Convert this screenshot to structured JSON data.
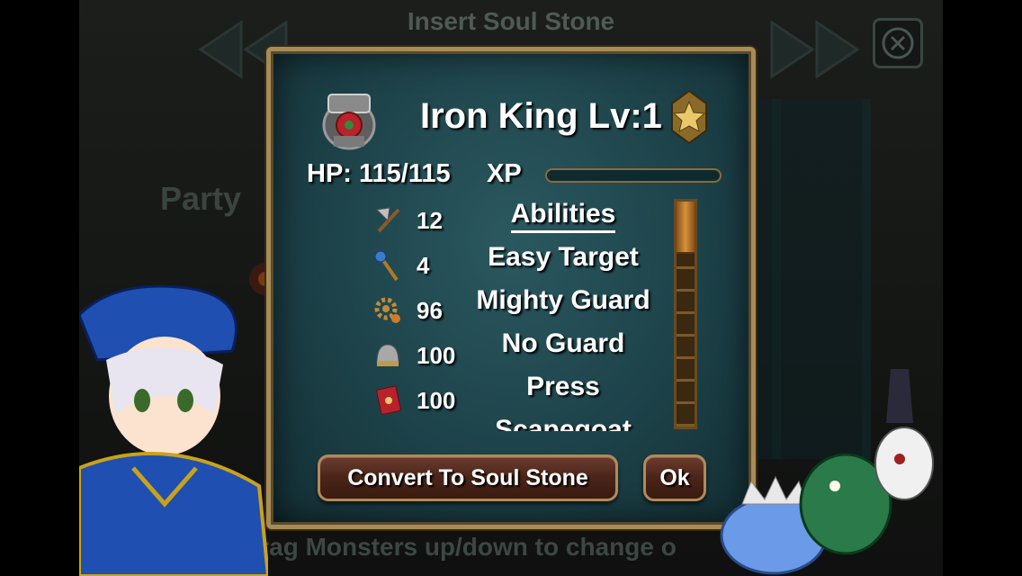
{
  "background": {
    "title": "Insert Soul Stone",
    "party_label": "Party",
    "hint": "Drag Monsters up/down to change o"
  },
  "dialog": {
    "title": "Iron King Lv:1",
    "hp": "HP: 115/115",
    "xp_label": "XP",
    "xp_fraction": 0,
    "stats": [
      {
        "icon": "axe-icon",
        "value": "12"
      },
      {
        "icon": "staff-icon",
        "value": "4"
      },
      {
        "icon": "gear-icon",
        "value": "96"
      },
      {
        "icon": "helmet-icon",
        "value": "100"
      },
      {
        "icon": "spellbook-icon",
        "value": "100"
      }
    ],
    "abilities_header": "Abilities",
    "abilities": [
      "Easy Target",
      "Mighty Guard",
      "No Guard",
      "Press",
      "Scapegoat"
    ],
    "buttons": {
      "convert": "Convert To Soul Stone",
      "ok": "Ok"
    }
  },
  "colors": {
    "panel": "#1d4249",
    "frame": "#a68c58",
    "button": "#4a2418",
    "text": "#ffffff"
  }
}
